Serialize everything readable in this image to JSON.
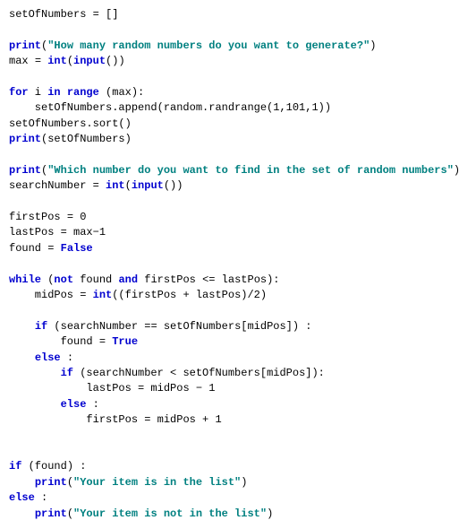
{
  "code": {
    "l1_a": "setOfNumbers ",
    "l1_b": " []",
    "eq": "=",
    "l3_a": "print",
    "l3_b": "(",
    "l3_c": "\"How many random numbers do you want to generate?\"",
    "l3_d": ")",
    "l4_a": "max ",
    "l4_b": " ",
    "l4_c": "int",
    "l4_d": "(",
    "l4_e": "input",
    "l4_f": "())",
    "l6_a": "for",
    "l6_b": " i ",
    "l6_c": "in",
    "l6_d": " ",
    "l6_e": "range",
    "l6_f": " (max):",
    "l7": "    setOfNumbers.append(random.randrange(",
    "l7_n1": "1",
    "l7_c1": ",",
    "l7_n2": "101",
    "l7_c2": ",",
    "l7_n3": "1",
    "l7_e": "))",
    "l8": "setOfNumbers.sort()",
    "l9_a": "print",
    "l9_b": "(setOfNumbers)",
    "l11_a": "print",
    "l11_b": "(",
    "l11_c": "\"Which number do you want to find in the set of random numbers\"",
    "l11_d": ")",
    "l12_a": "searchNumber ",
    "l12_b": " ",
    "l12_c": "int",
    "l12_d": "(",
    "l12_e": "input",
    "l12_f": "())",
    "l14_a": "firstPos ",
    "l14_b": " ",
    "l14_c": "0",
    "l15_a": "lastPos ",
    "l15_b": " max",
    "l15_c": "−",
    "l15_d": "1",
    "l16_a": "found ",
    "l16_b": " ",
    "l16_c": "False",
    "l18_a": "while",
    "l18_b": " (",
    "l18_c": "not",
    "l18_d": " found ",
    "l18_e": "and",
    "l18_f": " firstPos ",
    "l18_g": "<=",
    "l18_h": " lastPos):",
    "l19_a": "    midPos ",
    "l19_b": " ",
    "l19_c": "int",
    "l19_d": "((firstPos ",
    "l19_e": "+",
    "l19_f": " lastPos)",
    "l19_g": "/",
    "l19_h": "2",
    "l19_i": ")",
    "l21_a": "    ",
    "l21_b": "if",
    "l21_c": " (searchNumber ",
    "l21_d": "==",
    "l21_e": " setOfNumbers[midPos]) :",
    "l22_a": "        found ",
    "l22_b": " ",
    "l22_c": "True",
    "l23_a": "    ",
    "l23_b": "else",
    "l23_c": " :",
    "l24_a": "        ",
    "l24_b": "if",
    "l24_c": " (searchNumber ",
    "l24_d": "<",
    "l24_e": " setOfNumbers[midPos]):",
    "l25_a": "            lastPos ",
    "l25_b": " midPos ",
    "l25_c": "−",
    "l25_d": " ",
    "l25_e": "1",
    "l26_a": "        ",
    "l26_b": "else",
    "l26_c": " :",
    "l27_a": "            firstPos ",
    "l27_b": " midPos ",
    "l27_c": "+",
    "l27_d": " ",
    "l27_e": "1",
    "l30_a": "if",
    "l30_b": " (found) :",
    "l31_a": "    ",
    "l31_b": "print",
    "l31_c": "(",
    "l31_d": "\"Your item is in the list\"",
    "l31_e": ")",
    "l32_a": "else",
    "l32_b": " :",
    "l33_a": "    ",
    "l33_b": "print",
    "l33_c": "(",
    "l33_d": "\"Your item is not in the list\"",
    "l33_e": ")"
  }
}
